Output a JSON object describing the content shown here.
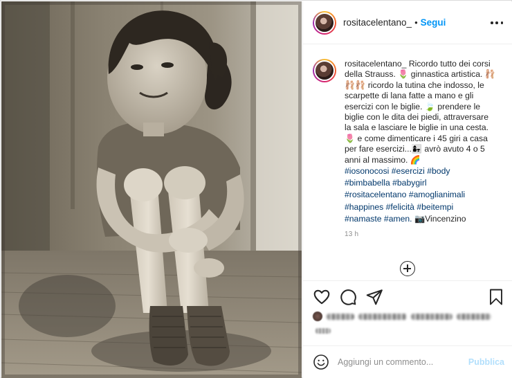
{
  "post": {
    "username": "rositacelentano_",
    "separator": "•",
    "follow_label": "Segui",
    "more_icon": "more-horizontal-icon"
  },
  "caption": {
    "username": "rositacelentano_",
    "text": " Ricordo tutto dei corsi della Strauss. 🌷 ginnastica artistica. 🩰🩰🩰 ricordo la tutina che indosso, le scarpette di lana fatte a mano e gli esercizi con le biglie. 🍃 prendere le biglie con le dita dei piedi, attraversare la sala e lasciare le biglie in una cesta. 🌷 e come dimenticare i 45 giri a casa per fare esercizi...👩‍👧 avrò avuto 4 o 5 anni al massimo. 🌈",
    "hashtags": [
      "#iosonocosi",
      "#esercizi",
      "#body",
      "#bimbabella",
      "#babygirl",
      "#rositacelentano",
      "#amoglianimali",
      "#happines",
      "#felicità",
      "#beitempi",
      "#namaste",
      "#amen."
    ],
    "trailing": "📷Vincenzino",
    "time_ago": "13 h"
  },
  "actions": {
    "like_icon": "heart-icon",
    "comment_icon": "comment-icon",
    "share_icon": "paper-plane-icon",
    "save_icon": "bookmark-icon"
  },
  "comment": {
    "placeholder": "Aggiungi un commento...",
    "publish_label": "Pubblica",
    "emoji_icon": "smiley-icon"
  },
  "colors": {
    "link": "#0095f6",
    "hashtag": "#00376b",
    "muted": "#8e8e8e",
    "publish_disabled": "#b2dffc"
  }
}
